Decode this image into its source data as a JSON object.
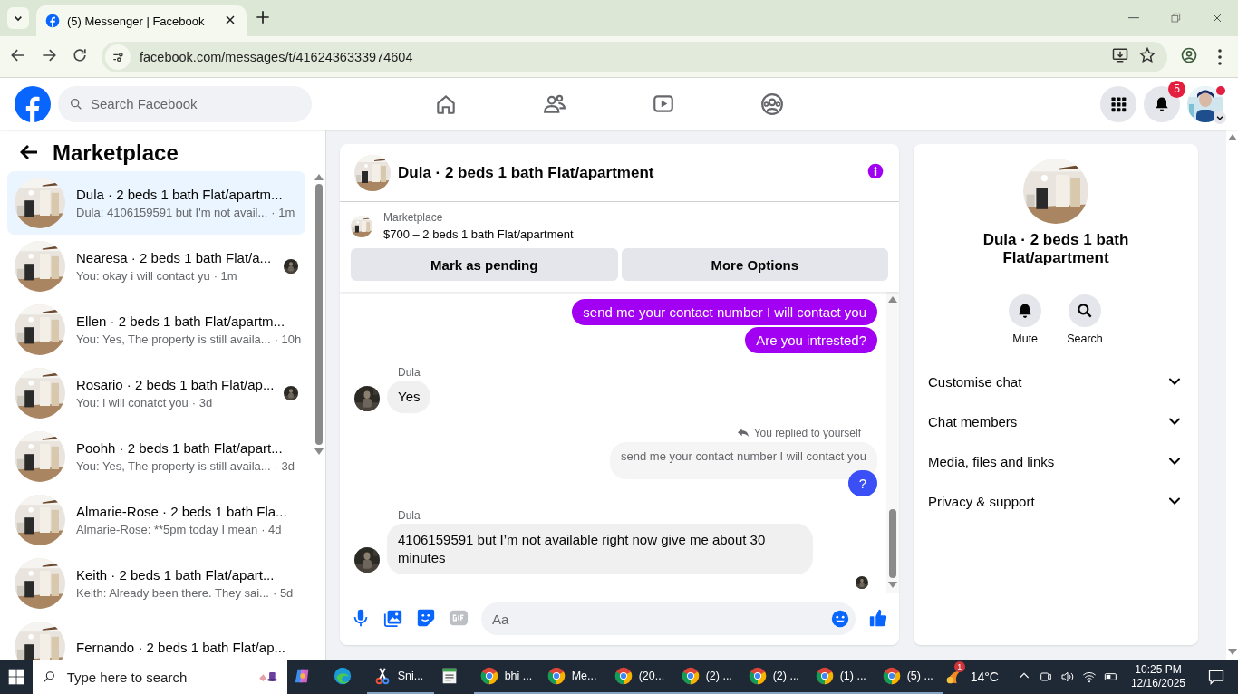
{
  "browser": {
    "tab_title": "(5) Messenger | Facebook",
    "url": "facebook.com/messages/t/4162436333974604"
  },
  "header": {
    "search_placeholder": "Search Facebook",
    "notification_count": "5"
  },
  "sidebar": {
    "title": "Marketplace",
    "conversations": [
      {
        "name": "Dula · 2 beds 1 bath Flat/apartm...",
        "preview": "Dula: 4106159591 but I'm not avail...",
        "time": "· 1m",
        "selected": true,
        "seen": false
      },
      {
        "name": "Nearesa · 2 beds 1 bath Flat/a...",
        "preview": "You: okay i will contact yu",
        "time": "· 1m",
        "selected": false,
        "seen": true
      },
      {
        "name": "Ellen · 2 beds 1 bath Flat/apartm...",
        "preview": "You: Yes, The property is still availa...",
        "time": "· 10h",
        "selected": false,
        "seen": false
      },
      {
        "name": "Rosario · 2 beds 1 bath Flat/ap...",
        "preview": "You: i will conatct you",
        "time": "· 3d",
        "selected": false,
        "seen": true
      },
      {
        "name": "Poohh · 2 beds 1 bath Flat/apart...",
        "preview": "You: Yes, The property is still availa...",
        "time": "· 3d",
        "selected": false,
        "seen": false
      },
      {
        "name": "Almarie-Rose · 2 beds 1 bath Fla...",
        "preview": "Almarie-Rose: **5pm today I mean",
        "time": "· 4d",
        "selected": false,
        "seen": false
      },
      {
        "name": "Keith · 2 beds 1 bath Flat/apart...",
        "preview": "Keith: Already been there. They sai...",
        "time": "· 5d",
        "selected": false,
        "seen": false
      },
      {
        "name": "Fernando · 2 beds 1 bath Flat/ap...",
        "selected": false,
        "seen": false
      }
    ]
  },
  "chat": {
    "title": "Dula · 2 beds 1 bath Flat/apartment",
    "listing": {
      "label": "Marketplace",
      "title": "$700 – 2 beds 1 bath Flat/apartment"
    },
    "buttons": [
      "Mark as pending",
      "More Options"
    ],
    "messages": [
      {
        "kind": "outgoing",
        "text": "send me your contact number I will contact you",
        "color": "#a100f2"
      },
      {
        "kind": "outgoing",
        "text": "Are you intrested?",
        "color": "#a100f2"
      },
      {
        "kind": "incoming",
        "sender": "Dula",
        "text": "Yes"
      },
      {
        "kind": "reply_note",
        "text": "You replied to yourself"
      },
      {
        "kind": "quoted",
        "text": "send me your contact number I will contact you"
      },
      {
        "kind": "outgoing",
        "text": "?",
        "color": "#3a4ff5"
      },
      {
        "kind": "incoming",
        "sender": "Dula",
        "text": "4106159591 but I’m not available right now give me about 30 minutes"
      },
      {
        "kind": "seen"
      }
    ],
    "composer_placeholder": "Aa"
  },
  "details": {
    "title": "Dula · 2 beds 1 bath Flat/apartment",
    "actions": [
      {
        "label": "Mute",
        "kind": "bell"
      },
      {
        "label": "Search",
        "kind": "search"
      }
    ],
    "sections": [
      {
        "label": "Customise chat",
        "expanded": false
      },
      {
        "label": "Chat members",
        "expanded": false
      },
      {
        "label": "Media, files and links",
        "expanded": false
      },
      {
        "label": "Privacy & support",
        "expanded": false
      }
    ]
  },
  "taskbar": {
    "search_placeholder": "Type here to search",
    "apps": [
      {
        "kind": "copilot"
      },
      {
        "kind": "edge"
      },
      {
        "kind": "snipping",
        "label": "Sni..."
      },
      {
        "kind": "notepad"
      },
      {
        "kind": "chrome",
        "label": "bhi ..."
      },
      {
        "kind": "chrome",
        "label": "Me..."
      },
      {
        "kind": "chrome",
        "label": "(20..."
      },
      {
        "kind": "chrome",
        "label": "(2) ..."
      },
      {
        "kind": "chrome",
        "label": "(2) ..."
      },
      {
        "kind": "chrome",
        "label": "(1) ..."
      },
      {
        "kind": "chrome",
        "label": "(5) ..."
      }
    ],
    "weather": {
      "badge": "1",
      "temperature": "14°C"
    },
    "time": "10:25 PM",
    "date": "12/16/2025"
  }
}
